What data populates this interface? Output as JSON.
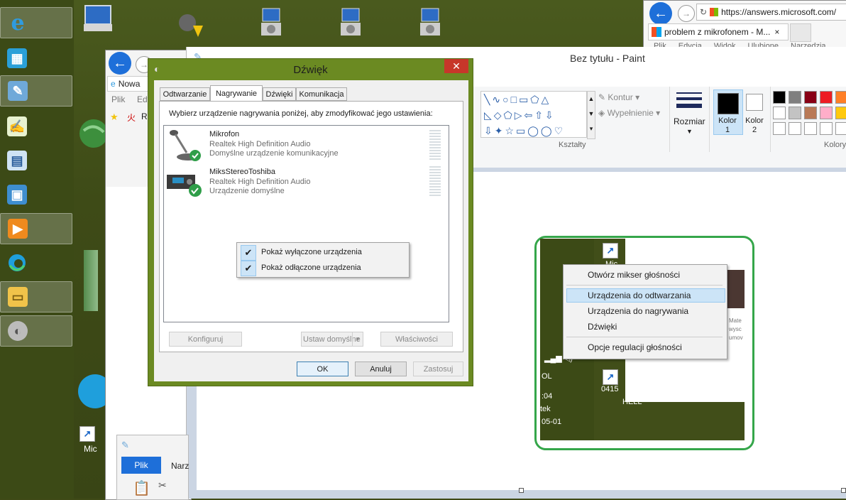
{
  "ie_top": {
    "url": "https://answers.microsoft.com/",
    "tab_title": "problem z mikrofonem - M...",
    "tab_close": "×",
    "menu": [
      "Plik",
      "Edycja",
      "Widok",
      "Ulubione",
      "Narzędzia"
    ]
  },
  "ie_left": {
    "tab_title": "Nowa",
    "menu_partial": [
      "Plik",
      "Edy"
    ],
    "fav_partial": "Ra"
  },
  "paint": {
    "title": "Bez tytułu - Paint",
    "outline_label": "Kontur",
    "fill_label": "Wypełnienie",
    "shapes_group": "Kształty",
    "size_label": "Rozmiar",
    "color1_label": "Kolor\n1",
    "color2_label": "Kolor\n2",
    "colors_group": "Kolory",
    "palette": [
      "#000000",
      "#7f7f7f",
      "#880015",
      "#ed1c24",
      "#ff7f27",
      "#ffffff",
      "#c3c3c3",
      "#b97a57",
      "#ffaec9",
      "#ffc90e"
    ]
  },
  "paint_small": {
    "tab_file": "Plik",
    "tab_partial": "Narz"
  },
  "dialog": {
    "title": "Dźwięk",
    "close": "✕",
    "tabs": [
      "Odtwarzanie",
      "Nagrywanie",
      "Dźwięki",
      "Komunikacja"
    ],
    "selected_tab": "Nagrywanie",
    "instruction": "Wybierz urządzenie nagrywania poniżej, aby zmodyfikować jego ustawienia:",
    "devices": [
      {
        "name": "Mikrofon",
        "driver": "Realtek High Definition Audio",
        "status": "Domyślne urządzenie komunikacyjne"
      },
      {
        "name": "MiksStereoToshiba",
        "driver": "Realtek High Definition Audio",
        "status": "Urządzenie domyślne"
      }
    ],
    "context_menu": [
      "Pokaż wyłączone urządzenia",
      "Pokaż odłączone urządzenia"
    ],
    "buttons": {
      "configure": "Konfiguruj",
      "set_default": "Ustaw domyślne",
      "properties": "Właściwości",
      "ok": "OK",
      "cancel": "Anuluj",
      "apply": "Zastosuj"
    }
  },
  "pasted_image": {
    "menu": [
      "Otwórz mikser głośności",
      "Urządzenia do odtwarzania",
      "Urządzenia do nagrywania",
      "Dźwięki",
      "Opcje regulacji głośności"
    ],
    "highlighted": "Urządzenia do odtwarzania",
    "labels": {
      "mic": "Mic",
      "num": "0415",
      "ol": "OL",
      "time": ":04",
      "tek": "tek",
      "date": "05-01",
      "hell": "HELL",
      "mate": "Mate",
      "wysc": "wysc",
      "umov": "umov"
    }
  },
  "desktop": {
    "mic_label": "Mic"
  },
  "ui_colors": {
    "desktop": "#3f4a17",
    "dialog_frame": "#6b8a22",
    "highlight": "#35a64a"
  }
}
